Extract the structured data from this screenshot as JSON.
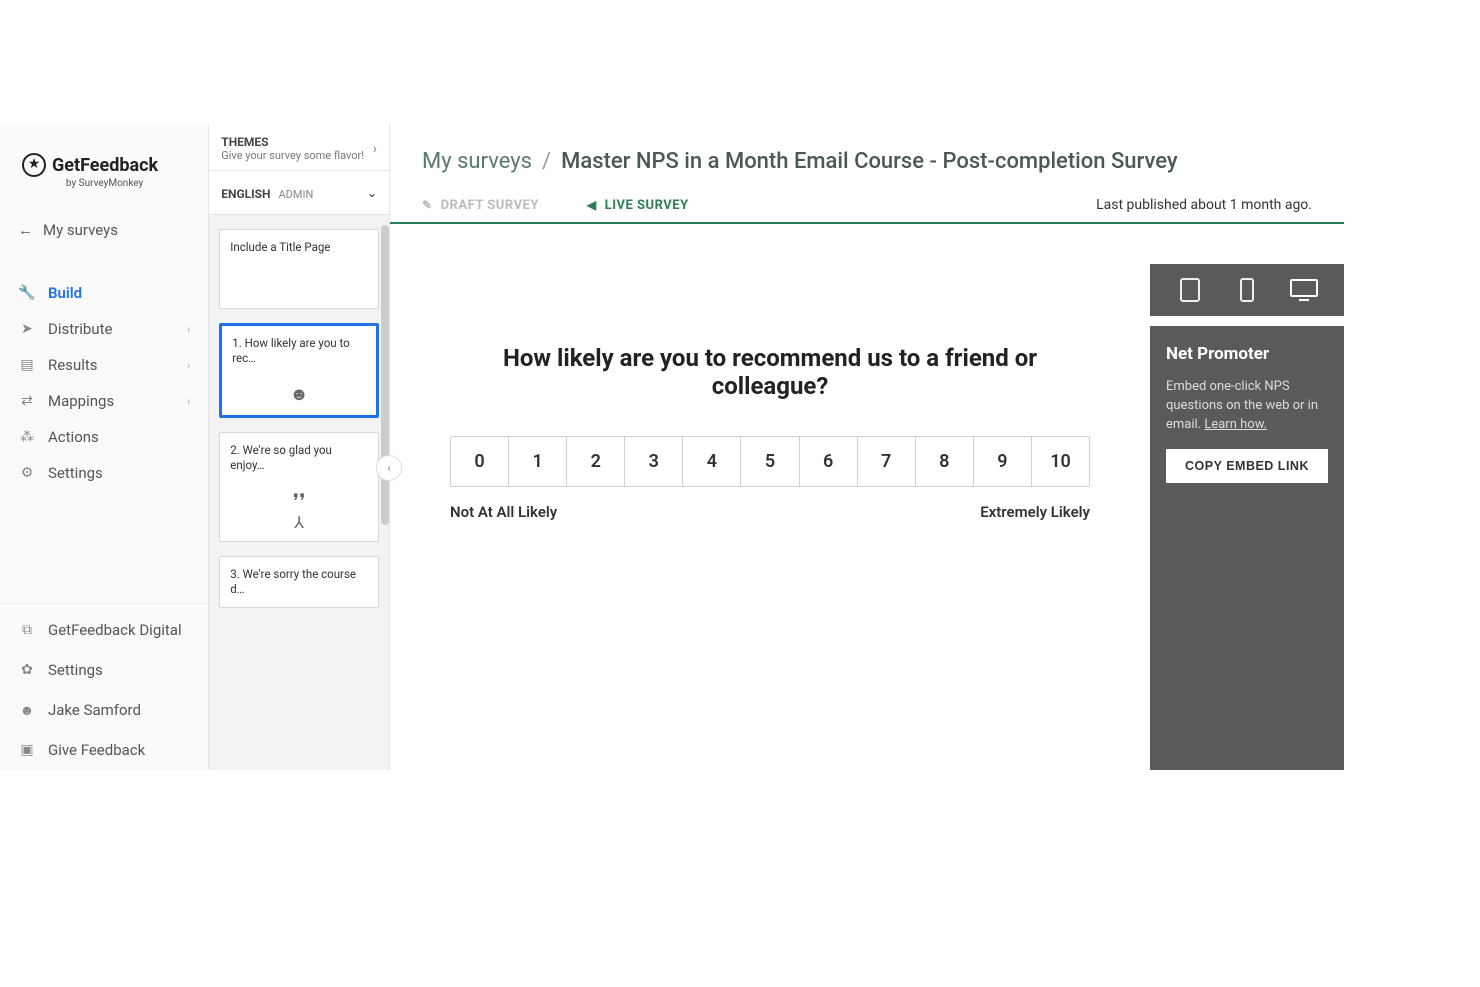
{
  "brand": {
    "name": "GetFeedback",
    "byline": "by SurveyMonkey"
  },
  "backLink": "My surveys",
  "nav": {
    "build": "Build",
    "distribute": "Distribute",
    "results": "Results",
    "mappings": "Mappings",
    "actions": "Actions",
    "settings": "Settings"
  },
  "bottomNav": {
    "digital": "GetFeedback Digital",
    "settings": "Settings",
    "user": "Jake Samford",
    "feedback": "Give Feedback"
  },
  "themes": {
    "label": "THEMES",
    "sub": "Give your survey some flavor!"
  },
  "language": {
    "label": "ENGLISH",
    "admin": "ADMIN"
  },
  "thumbs": {
    "titlepage": "Include a Title Page",
    "q1": "1. How likely are you to rec…",
    "q2": "2. We're so glad you enjoy…",
    "q3": "3. We're sorry the course d…"
  },
  "breadcrumb": {
    "root": "My surveys",
    "sep": "/",
    "current": "Master NPS in a Month Email Course - Post-completion Survey"
  },
  "tabs": {
    "draft": "DRAFT SURVEY",
    "live": "LIVE SURVEY"
  },
  "lastPublished": "Last published about 1 month ago.",
  "question": {
    "text": "How likely are you to recommend us to a friend or colleague?",
    "scale": [
      "0",
      "1",
      "2",
      "3",
      "4",
      "5",
      "6",
      "7",
      "8",
      "9",
      "10"
    ],
    "lowLabel": "Not At All Likely",
    "highLabel": "Extremely Likely"
  },
  "rightPanel": {
    "title": "Net Promoter",
    "body": "Embed one-click NPS questions on the web or in email. ",
    "learn": "Learn how.",
    "button": "COPY EMBED LINK"
  }
}
